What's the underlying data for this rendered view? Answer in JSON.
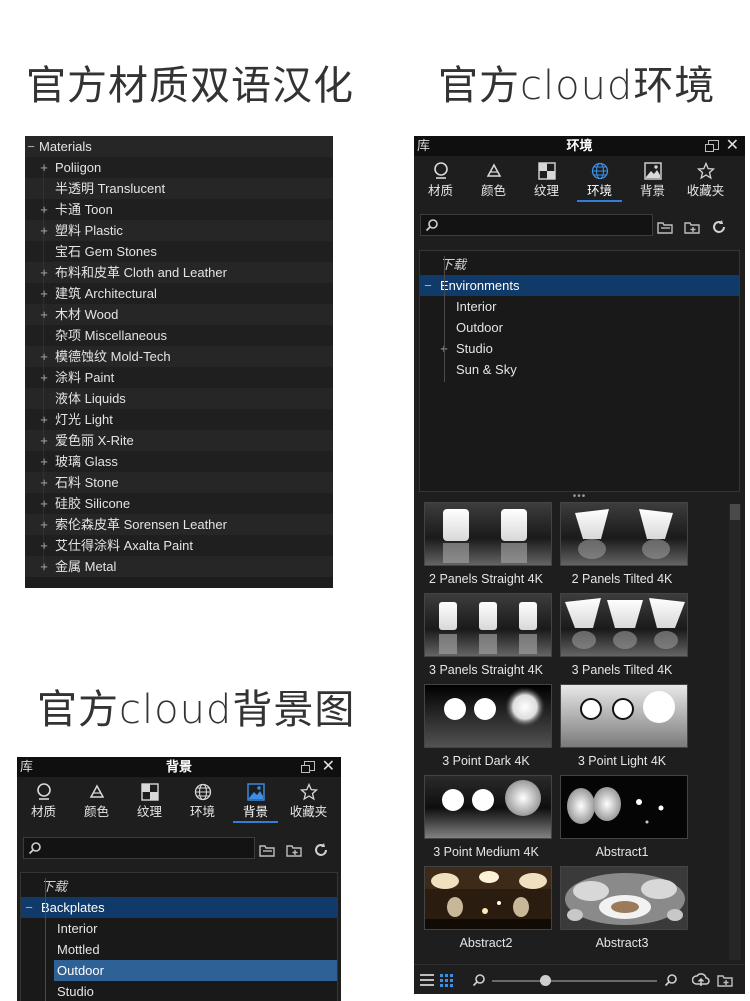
{
  "headings": {
    "materials": "官方材质双语汉化",
    "environments": "官方cloud环境",
    "backgrounds": "官方cloud背景图"
  },
  "materials_tree": {
    "root": "Materials",
    "items": [
      {
        "label": "Poliigon",
        "expandable": true
      },
      {
        "label": "半透明 Translucent",
        "expandable": false
      },
      {
        "label": "卡通 Toon",
        "expandable": true
      },
      {
        "label": "塑料 Plastic",
        "expandable": true
      },
      {
        "label": "宝石 Gem Stones",
        "expandable": false
      },
      {
        "label": "布料和皮革 Cloth and Leather",
        "expandable": true
      },
      {
        "label": "建筑 Architectural",
        "expandable": true
      },
      {
        "label": "木材 Wood",
        "expandable": true
      },
      {
        "label": "杂项 Miscellaneous",
        "expandable": false
      },
      {
        "label": "模德蚀纹 Mold-Tech",
        "expandable": true
      },
      {
        "label": "涂料 Paint",
        "expandable": true
      },
      {
        "label": "液体 Liquids",
        "expandable": false
      },
      {
        "label": "灯光 Light",
        "expandable": true
      },
      {
        "label": "爱色丽 X-Rite",
        "expandable": true
      },
      {
        "label": "玻璃 Glass",
        "expandable": true
      },
      {
        "label": "石料 Stone",
        "expandable": true
      },
      {
        "label": "硅胶 Silicone",
        "expandable": true
      },
      {
        "label": "索伦森皮革 Sorensen Leather",
        "expandable": true
      },
      {
        "label": "艾仕得涂料 Axalta Paint",
        "expandable": true
      },
      {
        "label": "金属 Metal",
        "expandable": true
      }
    ]
  },
  "library_common": {
    "library_label": "库",
    "tabs": [
      "材质",
      "颜色",
      "纹理",
      "环境",
      "背景",
      "收藏夹"
    ],
    "accent": "#2f7fd8"
  },
  "env_panel": {
    "title": "环境",
    "active_tab": "环境",
    "tree": [
      {
        "label": "下载",
        "indent": 0,
        "italic": true
      },
      {
        "label": "Environments",
        "indent": 0,
        "expander": "−",
        "selected": true
      },
      {
        "label": "Interior",
        "indent": 1
      },
      {
        "label": "Outdoor",
        "indent": 1
      },
      {
        "label": "Studio",
        "indent": 1,
        "expander": "+"
      },
      {
        "label": "Sun & Sky",
        "indent": 1
      }
    ],
    "thumbnails": [
      {
        "caption": "2 Panels Straight 4K",
        "kind": "panels-straight-2"
      },
      {
        "caption": "2 Panels Tilted 4K",
        "kind": "panels-tilted-2"
      },
      {
        "caption": "3 Panels Straight 4K",
        "kind": "panels-straight-3"
      },
      {
        "caption": "3 Panels Tilted 4K",
        "kind": "panels-tilted-3"
      },
      {
        "caption": "3 Point Dark 4K",
        "kind": "point-dark"
      },
      {
        "caption": "3 Point Light 4K",
        "kind": "point-light"
      },
      {
        "caption": "3 Point Medium 4K",
        "kind": "point-medium"
      },
      {
        "caption": "Abstract1",
        "kind": "abstract1"
      },
      {
        "caption": "Abstract2",
        "kind": "abstract2"
      },
      {
        "caption": "Abstract3",
        "kind": "abstract3"
      }
    ]
  },
  "bg_panel": {
    "title": "背景",
    "active_tab": "背景",
    "tree": [
      {
        "label": "下载",
        "indent": 0,
        "italic": true
      },
      {
        "label": "Backplates",
        "indent": 0,
        "expander": "−",
        "selected": true
      },
      {
        "label": "Interior",
        "indent": 1
      },
      {
        "label": "Mottled",
        "indent": 1
      },
      {
        "label": "Outdoor",
        "indent": 1,
        "highlight": true
      },
      {
        "label": "Studio",
        "indent": 1
      }
    ]
  }
}
